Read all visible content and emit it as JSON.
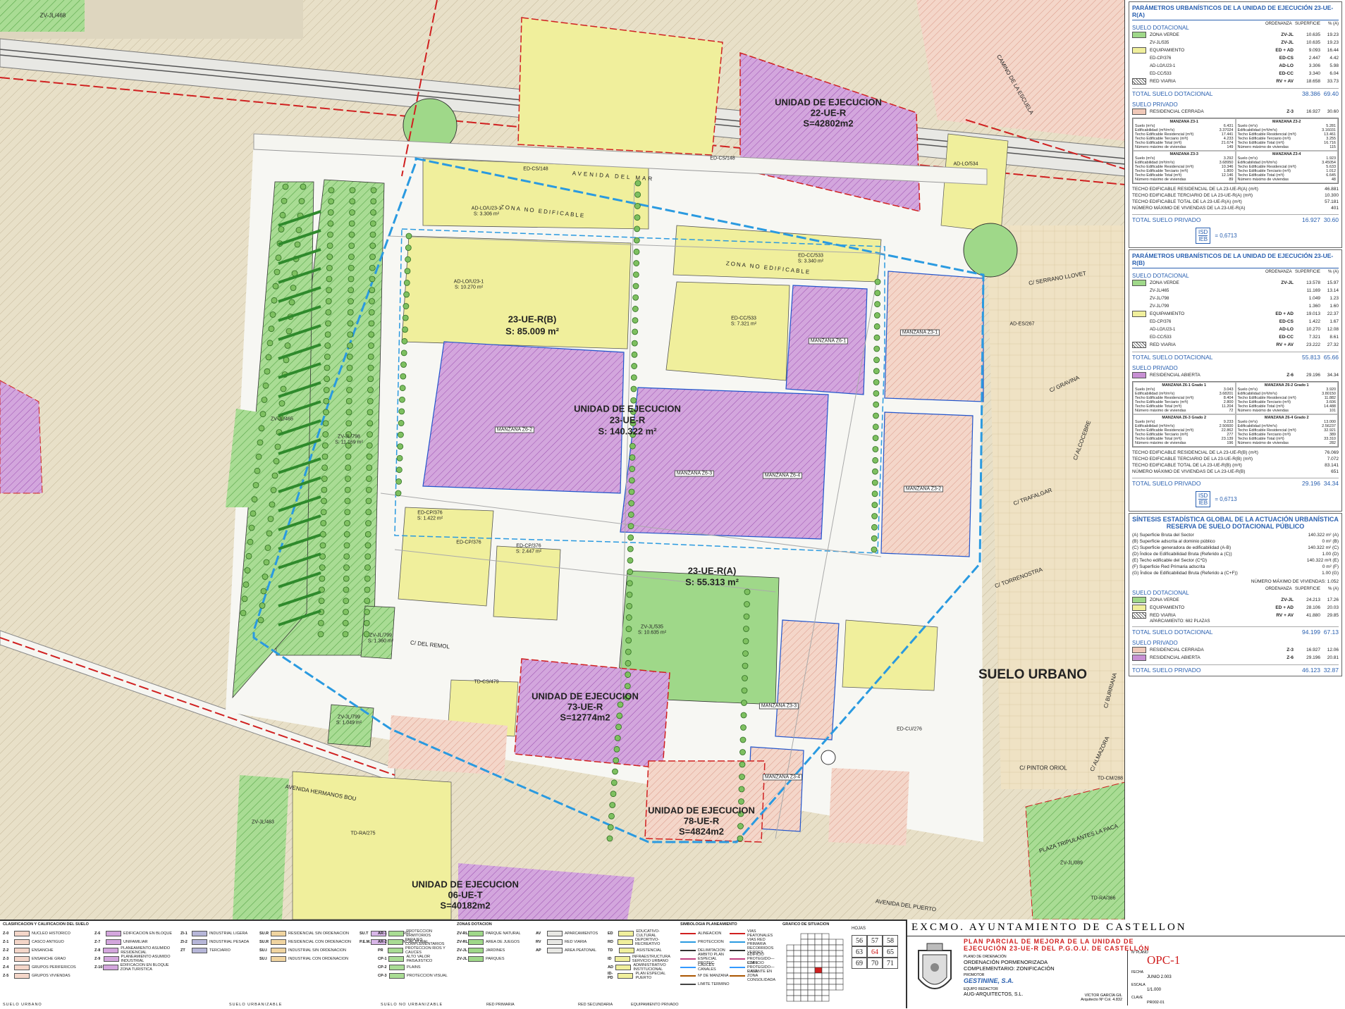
{
  "colors": {
    "verde": "#9fd889",
    "equip": "#f0ef9c",
    "residencial_cerrada": "#f0c8b8",
    "residencial_abierta": "#c890d4",
    "blue": "#2a9ae0",
    "red": "#d02020",
    "title": "#2a60b0"
  },
  "map": {
    "labels": {
      "zvjl468": "ZV-JL/468",
      "edcs148": "ED-CS/148",
      "edcs148b": "ED-CS/148",
      "ue22_l1": "UNIDAD DE EJECUCION",
      "ue22_l2": "22-UE-R",
      "ue22_l3": "S=42802m2",
      "adlo534": "AD-LO/534",
      "avenida_mar": "AVENIDA DEL MAR",
      "zona_no_edif": "ZONA NO EDIFICABLE",
      "zona_no_edif2": "ZONA NO EDIFICABLE",
      "adlou23_1": "AD-LO/U23-1",
      "adlou23_1s": "S: 3.306 m²",
      "adlou23_1b": "AD-LO/U23-1",
      "adlou23_1bs": "S: 10.270 m²",
      "edcc533": "ED-CC/533",
      "edcc533s": "S: 3.340 m²",
      "edcc533b": "ED-CC/533",
      "edcc533bs": "S: 7.321 m²",
      "b_l1": "23-UE-R(B)",
      "b_l2": "S: 85.009 m²",
      "mz_z6_1": "MANZANA Z6-1",
      "mz_z3_1": "MANZANA Z3-1",
      "mz_z6_2": "MANZANA Z6-2",
      "mz_z6_3": "MANZANA Z6-3",
      "mz_z6_4": "MANZANA Z6-4",
      "mz_z3_2": "MANZANA Z3-2",
      "mz_z3_3": "MANZANA Z3-3",
      "mz_z3_4": "MANZANA Z3-4",
      "ue23_l1": "UNIDAD DE EJECUCION",
      "ue23_l2": "23-UE-R",
      "ue23_l3": "S: 140.322 m²",
      "zvjl465": "ZV-JL/465",
      "zvjl798": "ZV-JL/798",
      "zvjl798s": "S: 11.169 m²",
      "edcp376": "ED-CP/376",
      "edcp376s": "S: 1.422 m²",
      "edcp376b": "ED-CP/376",
      "edcp376c": "ED-CP/376",
      "edcp376cs": "S: 2.447 m²",
      "a_l1": "23-UE-R(A)",
      "a_l2": "S: 55.313 m²",
      "zvjl535": "ZV-JL/535",
      "zvjl535s": "S: 10.635 m²",
      "zvjl799": "ZV-JL/799",
      "zvjl799s": "S: 1.360 m²",
      "zvjl799b": "ZV-JL/799",
      "zvjl799bs": "S: 1.049 m²",
      "tdcs479": "TD-CS/479",
      "ue73_l1": "UNIDAD DE EJECUCION",
      "ue73_l2": "73-UE-R",
      "ue73_l3": "S=12774m2",
      "ue78_l1": "UNIDAD DE EJECUCION",
      "ue78_l2": "78-UE-R",
      "ue78_l3": "S=4824m2",
      "ue06_l1": "UNIDAD DE EJECUCION",
      "ue06_l2": "06-UE-T",
      "ue06_l3": "S=40182m2",
      "zvjl463": "ZV-JL/463",
      "tdra275": "TD-RA/275",
      "suelo_urbano": "SUELO URBANO",
      "edcu276": "ED-CU/276",
      "tdcm288": "TD-CM/288",
      "zvjl089": "ZV-JL/089",
      "tdra366": "TD-RA/366",
      "ades267": "AD-ES/267",
      "c_gravina": "C/ GRAVINA",
      "c_trafalgar": "C/ TRAFALGAR",
      "c_torrenostra": "C/ TORRENOSTRA",
      "c_remol": "C/ DEL REMOL",
      "c_alcocebre": "C/ ALCOCEBRE",
      "c_serrano": "C/ SERRANO LLOVET",
      "avenida_bou": "AVENIDA HERMANOS BOU",
      "avenida_puerto": "AVENIDA DEL PUERTO",
      "camino_escuela": "CAMINO DE LA ESCUELA",
      "c_almazora": "C/ ALMAZORA",
      "c_pintor": "C/ PINTOR ORIOL",
      "c_burriana": "C/ BURRIANA",
      "plaza": "PLAZA TRIPULANTES LA PACA"
    }
  },
  "panel": {
    "a": {
      "title": "PARÁMETROS URBANÍSTICOS DE LA UNIDAD DE EJECUCIÓN 23-UE-R(A)",
      "dot": "SUELO DOTACIONAL",
      "h_ord": "ORDENANZA",
      "h_sup": "SUPERFICIE",
      "h_pct": "% (A)",
      "rows": [
        {
          "n": "ZONA VERDE",
          "o": "ZV-JL",
          "s": "10.635",
          "p": "19.23",
          "sw": "verde"
        },
        {
          "n": "ZV-JL/535",
          "o": "ZV-JL",
          "s": "10.635",
          "p": "19.23",
          "sw": ""
        },
        {
          "n": "EQUIPAMIENTO",
          "o": "ED + AD",
          "s": "9.093",
          "p": "16.44",
          "sw": "equip"
        },
        {
          "n": "ED-CP/376",
          "o": "ED-CS",
          "s": "2.447",
          "p": "4.42",
          "sw": ""
        },
        {
          "n": "AD-LO/U23-1",
          "o": "AD-LO",
          "s": "3.306",
          "p": "5.98",
          "sw": ""
        },
        {
          "n": "ED-CC/533",
          "o": "ED-CC",
          "s": "3.340",
          "p": "6.04",
          "sw": ""
        },
        {
          "n": "RED VIARIA",
          "o": "RV + AV",
          "s": "18.658",
          "p": "33.73",
          "sw": "viaria"
        }
      ],
      "tot_dot": "TOTAL SUELO DOTACIONAL",
      "tot_dot_s": "38.386",
      "tot_dot_p": "69.40",
      "priv": "SUELO PRIVADO",
      "priv_row": {
        "n": "RESIDENCIAL CERRADA",
        "o": "Z-3",
        "s": "16.927",
        "p": "30.60"
      },
      "m1_h": "MANZANA Z3-1",
      "m2_h": "MANZANA Z3-2",
      "m3_h": "MANZANA Z3-3",
      "m4_h": "MANZANA Z3-4",
      "m1": [
        [
          "Suelo (m²s)",
          "6.431"
        ],
        [
          "Edificabilidad (m²t/m²s)",
          "3.37024"
        ],
        [
          "Techo Edificable Residencial (m²t)",
          "17.441"
        ],
        [
          "Techo Edificable Terciario (m²t)",
          "4.233"
        ],
        [
          "Techo Edificable Total (m²t)",
          "21.674"
        ],
        [
          "Número máximo de viviendas",
          "149"
        ]
      ],
      "m2": [
        [
          "Suelo (m²s)",
          "5.281"
        ],
        [
          "Edificabilidad (m²t/m²s)",
          "3.16031"
        ],
        [
          "Techo Edificable Residencial (m²t)",
          "13.461"
        ],
        [
          "Techo Edificable Terciario (m²t)",
          "3.255"
        ],
        [
          "Techo Edificable Total (m²t)",
          "16.716"
        ],
        [
          "Número máximo de viviendas",
          "115"
        ]
      ],
      "m3": [
        [
          "Suelo (m²s)",
          "3.292"
        ],
        [
          "Edificabilidad (m²t/m²s)",
          "3.68950"
        ],
        [
          "Techo Edificable Residencial (m²t)",
          "10.346"
        ],
        [
          "Techo Edificable Terciario (m²t)",
          "1.800"
        ],
        [
          "Techo Edificable Total (m²t)",
          "12.146"
        ],
        [
          "Número máximo de viviendas",
          "89"
        ]
      ],
      "m4": [
        [
          "Suelo (m²s)",
          "1.923"
        ],
        [
          "Edificabilidad (m²t/m²s)",
          "3.45054"
        ],
        [
          "Techo Edificable Residencial (m²t)",
          "5.633"
        ],
        [
          "Techo Edificable Terciario (m²t)",
          "1.012"
        ],
        [
          "Techo Edificable Total (m²t)",
          "6.645"
        ],
        [
          "Número máximo de viviendas",
          "48"
        ]
      ],
      "sum": [
        [
          "TECHO EDIFICABLE RESIDENCIAL DE LA 23-UE-R(A) (m²t)",
          "46.881"
        ],
        [
          "TECHO EDIFICABLE TERCIARIO DE LA 23-UE-R(A) (m²t)",
          "10.300"
        ],
        [
          "TECHO EDIFICABLE TOTAL DE LA 23-UE-R(A) (m²t)",
          "57.181"
        ],
        [
          "NÚMERO MÁXIMO DE VIVIENDAS DE LA 23-UE-R(A)",
          "401"
        ]
      ],
      "tot_priv": "TOTAL SUELO PRIVADO",
      "tot_priv_s": "16.927",
      "tot_priv_p": "30.60",
      "isd_top": "ISD",
      "isd_bot": "IEB",
      "isd_val": "= 0,6713"
    },
    "b": {
      "title": "PARÁMETROS URBANÍSTICOS DE LA UNIDAD DE EJECUCIÓN 23-UE-R(B)",
      "dot": "SUELO DOTACIONAL",
      "h_ord": "ORDENANZA",
      "h_sup": "SUPERFICIE",
      "h_pct": "% (A)",
      "rows": [
        {
          "n": "ZONA VERDE",
          "o": "ZV-JL",
          "s": "13.578",
          "p": "15.97",
          "sw": "verde"
        },
        {
          "n": "ZV-JL/465",
          "o": "",
          "s": "11.169",
          "p": "13.14",
          "sw": ""
        },
        {
          "n": "ZV-JL/798",
          "o": "",
          "s": "1.049",
          "p": "1.23",
          "sw": ""
        },
        {
          "n": "ZV-JL/799",
          "o": "",
          "s": "1.360",
          "p": "1.60",
          "sw": ""
        },
        {
          "n": "EQUIPAMIENTO",
          "o": "ED + AD",
          "s": "19.013",
          "p": "22.37",
          "sw": "equip"
        },
        {
          "n": "ED-CP/376",
          "o": "ED-CS",
          "s": "1.422",
          "p": "1.67",
          "sw": ""
        },
        {
          "n": "AD-LO/U23-1",
          "o": "AD-LO",
          "s": "10.270",
          "p": "12.08",
          "sw": ""
        },
        {
          "n": "ED-CC/533",
          "o": "ED-CC",
          "s": "7.321",
          "p": "8.61",
          "sw": ""
        },
        {
          "n": "RED VIARIA",
          "o": "RV + AV",
          "s": "23.222",
          "p": "27.32",
          "sw": "viaria"
        }
      ],
      "tot_dot": "TOTAL SUELO DOTACIONAL",
      "tot_dot_s": "55.813",
      "tot_dot_p": "65.66",
      "priv": "SUELO PRIVADO",
      "priv_row": {
        "n": "RESIDENCIAL ABIERTA",
        "o": "Z-6",
        "s": "29.196",
        "p": "34.34"
      },
      "m1_h": "MANZANA Z6-1 Grado 1",
      "m2_h": "MANZANA Z6-2 Grado 1",
      "m3_h": "MANZANA Z6-3 Grado 2",
      "m4_h": "MANZANA Z6-4 Grado 2",
      "m1": [
        [
          "Suelo (m²s)",
          "3.043"
        ],
        [
          "Edificabilidad (m²t/m²s)",
          "3.68201"
        ],
        [
          "Techo Edificable Residencial (m²t)",
          "8.404"
        ],
        [
          "Techo Edificable Terciario (m²t)",
          "2.800"
        ],
        [
          "Techo Edificable Total (m²t)",
          "11.204"
        ],
        [
          "Número máximo de viviendas",
          "72"
        ]
      ],
      "m2": [
        [
          "Suelo (m²s)",
          "3.920"
        ],
        [
          "Edificabilidad (m²t/m²s)",
          "3.80150"
        ],
        [
          "Techo Edificable Residencial (m²t)",
          "11.882"
        ],
        [
          "Techo Edificable Terciario (m²t)",
          "3.606"
        ],
        [
          "Techo Edificable Total (m²t)",
          "14.488"
        ],
        [
          "Número máximo de viviendas",
          "101"
        ]
      ],
      "m3": [
        [
          "Suelo (m²s)",
          "9.233"
        ],
        [
          "Edificabilidad (m²t/m²s)",
          "2.50600"
        ],
        [
          "Techo Edificable Residencial (m²t)",
          "22.862"
        ],
        [
          "Techo Edificable Terciario (m²t)",
          "277"
        ],
        [
          "Techo Edificable Total (m²t)",
          "23.139"
        ],
        [
          "Número máximo de viviendas",
          "196"
        ]
      ],
      "m4": [
        [
          "Suelo (m²s)",
          "13.000"
        ],
        [
          "Edificabilidad (m²t/m²s)",
          "2.56237"
        ],
        [
          "Techo Edificable Residencial (m²t)",
          "32.921"
        ],
        [
          "Techo Edificable Terciario (m²t)",
          "389"
        ],
        [
          "Techo Edificable Total (m²t)",
          "33.310"
        ],
        [
          "Número máximo de viviendas",
          "282"
        ]
      ],
      "sum": [
        [
          "TECHO EDIFICABLE RESIDENCIAL DE LA 23-UE-R(B) (m²t)",
          "76.069"
        ],
        [
          "TECHO EDIFICABLE TERCIARIO DE LA 23-UE-R(B) (m²t)",
          "7.072"
        ],
        [
          "TECHO EDIFICABLE TOTAL DE LA 23-UE-R(B) (m²t)",
          "83.141"
        ],
        [
          "NÚMERO MÁXIMO DE VIVIENDAS DE LA 23-UE-R(B)",
          "651"
        ]
      ],
      "tot_priv": "TOTAL SUELO PRIVADO",
      "tot_priv_s": "29.196",
      "tot_priv_p": "34.34",
      "isd_top": "ISD",
      "isd_bot": "IEB",
      "isd_val": "= 0,6713"
    },
    "s": {
      "t1": "SÍNTESIS ESTADÍSTICA GLOBAL DE LA ACTUACIÓN URBANÍSTICA",
      "t2": "RESERVA DE SUELO DOTACIONAL PÚBLICO",
      "lines": [
        [
          "(A)  Superficie Bruta del Sector",
          "140.322 m²  (A)"
        ],
        [
          "(B)  Superficie adscrita al dominio público",
          "0 m²  (B)"
        ],
        [
          "(C)  Superficie generadora de edificabilidad (A-B)",
          "140.322 m²  (C)"
        ],
        [
          "(D)  Índice de Edificabilidad Bruta (Referido a (C))",
          "1.00  (D)"
        ],
        [
          "(E)  Techo edificable del Sector (C*D)",
          "140.322 m²t  (E)"
        ],
        [
          "(F)  Superficie Red Primaria adscrita",
          "0 m²  (F)"
        ],
        [
          "(G)  Índice de Edificabilidad Bruta (Referido a (C+F))",
          "1.00  (G)"
        ]
      ],
      "viv": "NÚMERO MÁXIMO DE VIVIENDAS: 1.052",
      "dot": "SUELO DOTACIONAL",
      "h_ord": "ORDENANZA",
      "h_sup": "SUPERFICIE",
      "h_pct": "% (A)",
      "rows": [
        {
          "n": "ZONA VERDE",
          "o": "ZV-JL",
          "s": "24.213",
          "p": "17.26",
          "sw": "verde"
        },
        {
          "n": "EQUIPAMIENTO",
          "o": "ED + AD",
          "s": "28.106",
          "p": "20.03",
          "sw": "equip"
        },
        {
          "n": "RED VIARIA",
          "o": "RV + AV",
          "s": "41.880",
          "p": "29.85",
          "sw": "viaria"
        }
      ],
      "aparc": "APARCAMIENTO:   682 PLAZAS",
      "tot_dot": "TOTAL SUELO DOTACIONAL",
      "tot_dot_s": "94.199",
      "tot_dot_p": "67.13",
      "priv": "SUELO PRIVADO",
      "prows": [
        {
          "n": "RESIDENCIAL CERRADA",
          "o": "Z-3",
          "s": "16.927",
          "p": "12.06",
          "sw": "residencial_cerrada"
        },
        {
          "n": "RESIDENCIAL ABIERTA",
          "o": "Z-6",
          "s": "29.196",
          "p": "20.81",
          "sw": "residencial_abierta"
        }
      ],
      "tot_priv": "TOTAL SUELO PRIVADO",
      "tot_priv_s": "46.123",
      "tot_priv_p": "32.87"
    }
  },
  "title_block": {
    "ayto": "EXCMO. AYUNTAMIENTO DE CASTELLON",
    "plan1": "PLAN PARCIAL DE MEJORA DE LA UNIDAD DE",
    "plan2": "EJECUCIÓN 23-UE-R DEL P.G.O.U. DE CASTELLÓN",
    "lbl_plano": "PLANO DE ORDENACIÓN",
    "plano1": "ORDENACIÓN PORMENORIZADA",
    "plano2": "COMPLEMENTARIO: ZONIFICACIÓN",
    "lbl_promotor": "PROMOTOR",
    "promotor": "GESTININE, S.A.",
    "lbl_equipo": "EQUIPO REDACTOR",
    "equipo": "AUG-ARQUITECTOS, S.L.",
    "lbl_nplano": "Nº PLANO",
    "nplano": "OPC-1",
    "lbl_fecha": "FECHA",
    "fecha": "JUNIO 2.003",
    "lbl_escala": "ESCALA",
    "escala": "1/1.000",
    "lbl_clave": "CLAVE",
    "clave": "PR002-01",
    "firma1": "VÍCTOR GARCÍA GIL",
    "firma2": "Arquitecto   Nº Col. 4.832",
    "hojas": "HOJAS",
    "hojas_nums": [
      "56",
      "57",
      "58",
      "63",
      "64",
      "65",
      "69",
      "70",
      "71"
    ],
    "grafico": "GRAFICO DE SITUACION"
  },
  "legend": {
    "h1": "CLASIFICACION Y CALIFICACION DEL SUELO",
    "h2": "ZONAS DOTACION",
    "h3": "SIMBOLOGIA PLANEAMIENTO",
    "col1": [
      [
        "Z-0",
        "NUCLEO HISTORICO"
      ],
      [
        "Z-1",
        "CASCO ANTIGUO"
      ],
      [
        "Z-2",
        "ENSANCHE"
      ],
      [
        "Z-3",
        "ENSANCHE GRAO"
      ],
      [
        "Z-4",
        "GRUPOS PERIFERICOS"
      ],
      [
        "Z-5",
        "GRUPOS VIVIENDAS"
      ]
    ],
    "col2": [
      [
        "Z-6",
        "EDIFICACION EN BLOQUE"
      ],
      [
        "Z-7",
        "UNIFAMILIAR"
      ],
      [
        "Z-8",
        "PLANEAMIENTO ASUMIDO RESIDENCIAL"
      ],
      [
        "Z-9",
        "PLANEAMIENTO ASUMIDO INDUSTRIAL"
      ],
      [
        "Z-10",
        "EDIFICACION EN BLOQUE ZONA TURISTICA"
      ]
    ],
    "col3": [
      [
        "ZI-1",
        "INDUSTRIAL LIGERA"
      ],
      [
        "ZI-2",
        "INDUSTRIAL PESADA"
      ],
      [
        "ZT",
        "TERCIARIO"
      ]
    ],
    "col4": [
      [
        "SU.R",
        "RESIDENCIAL SIN ORDENACION"
      ],
      [
        "SU.R",
        "RESIDENCIAL CON ORDENACION"
      ],
      [
        "SU.I",
        "INDUSTRIAL SIN ORDENACION"
      ],
      [
        "SU.I",
        "INDUSTRIAL CON ORDENACION"
      ]
    ],
    "col5": [
      [
        "SU.T",
        "TERCIARIO"
      ],
      [
        "P.E.M.",
        "RESIDENCIAL RURAL"
      ]
    ],
    "col6": [
      [
        "AR-1",
        "PROTECCION ERMITORIOS"
      ],
      [
        "AR-2",
        "PARAJES COMPLEMENTARIOS"
      ],
      [
        "PR",
        "PROTECCION RIOS Y CAUCES"
      ],
      [
        "CP-1",
        "ALTO VALOR PAISAJISTICO"
      ],
      [
        "CP-2",
        "PLAINS"
      ],
      [
        "CP-3",
        "PROTECCION VISUAL"
      ]
    ],
    "col7": [
      [
        "ZV-RL",
        "PARQUE NATURAL"
      ],
      [
        "ZV-RL",
        "AREA DE JUEGOS"
      ],
      [
        "ZV-JL",
        "JARDINES"
      ],
      [
        "ZV-JL",
        "PARQUES"
      ]
    ],
    "col8": [
      [
        "AV",
        "APARCAMIENTOS"
      ],
      [
        "RV",
        "RED VIARIA"
      ],
      [
        "AP",
        "AREA PEATONAL"
      ]
    ],
    "col9": [
      [
        "ED",
        "EDUCATIVO-CULTURAL"
      ],
      [
        "RD",
        "DEPORTIVO-RECREATIVO"
      ],
      [
        "TD",
        "ASISTENCIAL"
      ],
      [
        "ID",
        "INFRAESTRUCTURA SERVICIO URBANO"
      ],
      [
        "AD",
        "ADMINISTRATIVO INSTITUCIONAL"
      ],
      [
        "ID-PD",
        "PLAN ESPECIAL PUERTO"
      ]
    ],
    "col10": [
      [
        "ALINEACION"
      ],
      [
        "PROTECCION"
      ],
      [
        "DELIMITACION"
      ],
      [
        "AMBITO PLAN ESPECIAL PROTEC."
      ],
      [
        "CAUCES CANALES"
      ],
      [
        "Nº DE MANZANA"
      ],
      [
        "LIMITE TERMINO"
      ]
    ],
    "col11": [
      [
        "VIAS PEATONALES"
      ],
      [
        "VIAS RED PRIMARIA"
      ],
      [
        "RECORRIDOS VERDES"
      ],
      [
        "EDIFICIO PROTEGIDO—C.M.I."
      ],
      [
        "EDIFICIO PROTEGIDO—E.S.O."
      ],
      [
        "RASANTE EN ZONA CONSOLIDADA"
      ]
    ],
    "foot1": "SUELO URBANO",
    "foot2": "SUELO URBANIZABLE",
    "foot3": "SUELO NO URBANIZABLE",
    "foot4": "RED PRIMARIA",
    "foot5": "RED SECUNDARIA",
    "foot6": "EQUIPAMIENTO PRIVADO"
  }
}
